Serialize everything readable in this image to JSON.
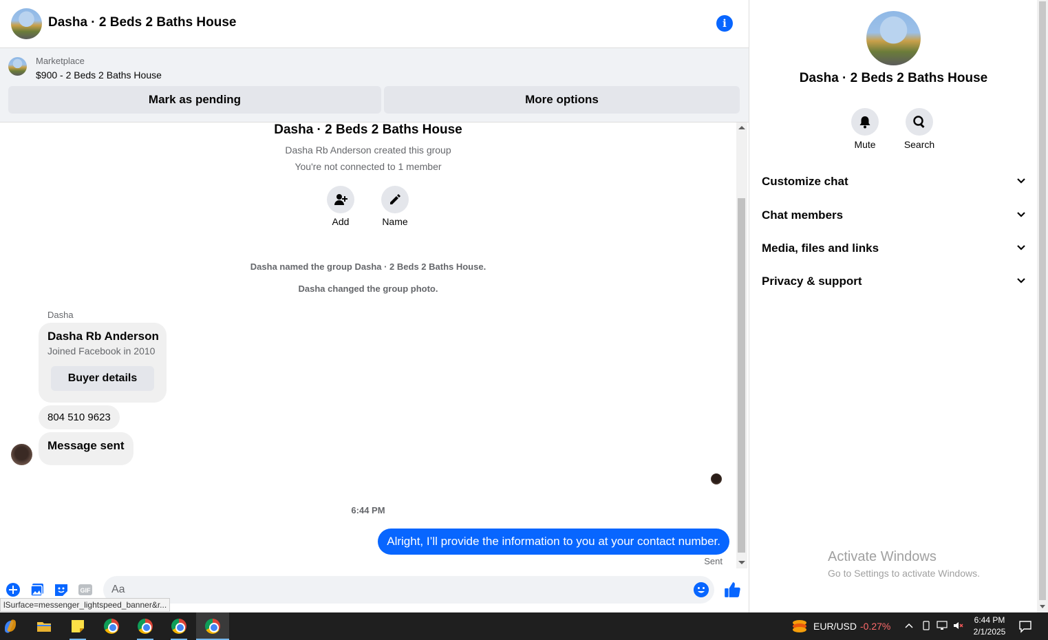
{
  "header": {
    "title": "Dasha · 2 Beds 2 Baths House"
  },
  "marketplace": {
    "label": "Marketplace",
    "item": "$900 - 2 Beds 2 Baths House",
    "mark_pending_label": "Mark as pending",
    "more_options_label": "More options"
  },
  "thread": {
    "group_title": "Dasha · 2 Beds 2 Baths House",
    "created_text": "Dasha Rb Anderson created this group",
    "not_connected_text": "You're not connected to 1 member",
    "add_label": "Add",
    "name_label": "Name",
    "event_named": "Dasha named the group Dasha · 2 Beds 2 Baths House.",
    "event_photo": "Dasha changed the group photo.",
    "sender_name": "Dasha",
    "buyer_card": {
      "name": "Dasha Rb Anderson",
      "joined": "Joined Facebook in 2010",
      "button_label": "Buyer details"
    },
    "phone_message": "804 510 9623",
    "message_sent": "Message sent",
    "timestamp": "6:44 PM",
    "outgoing_message": "Alright, I’ll provide the information to you at your contact number.",
    "sent_status": "Sent"
  },
  "composer": {
    "placeholder": "Aa",
    "gif_label": "GIF"
  },
  "status_url": "lSurface=messenger_lightspeed_banner&r...",
  "panel": {
    "title": "Dasha · 2 Beds 2 Baths House",
    "mute_label": "Mute",
    "search_label": "Search",
    "sections": [
      "Customize chat",
      "Chat members",
      "Media, files and links",
      "Privacy & support"
    ]
  },
  "watermark": {
    "line1": "Activate Windows",
    "line2": "Go to Settings to activate Windows."
  },
  "taskbar": {
    "ticker_symbol": "EUR/USD",
    "ticker_change": "-0.27%",
    "time": "6:44 PM",
    "date": "2/1/2025"
  },
  "colors": {
    "accent": "#0866ff",
    "bubble_in": "#f0f0f0",
    "negative": "#ff6b6b"
  }
}
